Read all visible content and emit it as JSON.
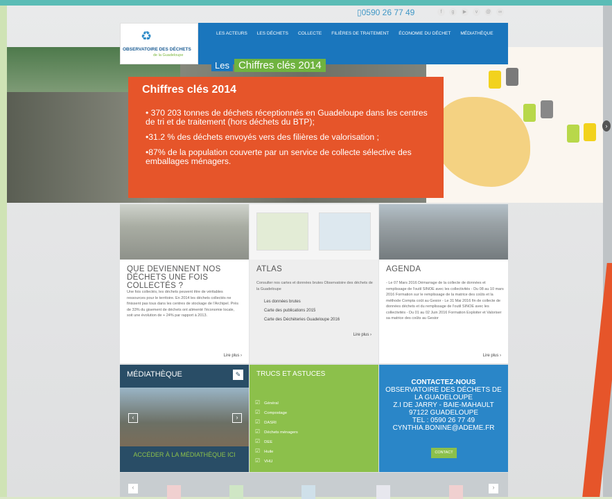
{
  "header": {
    "phone": "0590 26 77 49",
    "logo_name": "OBSERVATOIRE DES DÉCHETS",
    "logo_sub": "de la Guadeloupe",
    "nav": [
      "LES ACTEURS",
      "LES DÉCHETS",
      "COLLECTE",
      "FILIÈRES DE TRAITEMENT",
      "ÉCONOMIE DU DÉCHET",
      "MÉDIATHÈQUE"
    ]
  },
  "hero": {
    "badge_les": "Les",
    "badge_title": "Chiffres clés 2014",
    "title": "Chiffres clés 2014",
    "bullets": [
      "• 370 203 tonnes de déchets réceptionnés en Guadeloupe dans les centres de tri et de traitement (hors déchets du BTP);",
      "•31.2 % des déchets envoyés vers des filières de valorisation ;",
      "•87% de la population couverte par un service de collecte sélective des emballages ménagers."
    ]
  },
  "col1": {
    "title": "QUE DEVIENNENT NOS DÉCHETS UNE FOIS COLLECTÉS ?",
    "text": "Une fois collectés, les déchets peuvent être de véritables ressources pour le territoire. En 2014 les déchets collectés ne finissent pas tous dans les centres de stockage de l'Archipel. Près de 33% du gisement de déchets ont alimenté l'économie locale, soit une évolution de + 24% par rapport à 2013.",
    "more": "Lire plus ›"
  },
  "col2": {
    "title": "ATLAS",
    "text": "Consulter nos cartes et données brutes Observatoire des déchets de la Guadeloupe",
    "links": [
      "Les données brutes",
      "Carte des publications 2015",
      "Carte des Déchèteries Guadeloupe 2016"
    ],
    "more": "Lire plus ›"
  },
  "col3": {
    "title": "AGENDA",
    "text": "- Le 07 Mars 2016 Démarrage de la collecte de données et remplissage de l'outil SINOE avec les collectivités - Du 08 au 10 mars 2016 Formation sur le remplissage de la matrice des coûts et la méthode Compta coût au Gesior - Le 31 Mai 2016 fin de collecte de données déchets et du remplissage de l'outil SINOE avec les collectivités - Du 01 au 02 Juin 2016 Formation Exploiter et Valoriser sa matrice des coûts au Gesior",
    "more": "Lire plus ›"
  },
  "media": {
    "title": "MÉDIATHÈQUE",
    "cta": "ACCÉDER À LA MÉDIATHÈQUE ICI"
  },
  "tips": {
    "title": "TRUCS ET ASTUCES",
    "items": [
      "Général",
      "Compostage",
      "DASRI",
      "Déchets ménagers",
      "DEE",
      "Huile",
      "VHU"
    ]
  },
  "contact": {
    "title": "CONTACTEZ-NOUS",
    "lines": [
      "OBSERVATOIRE DES DÉCHETS DE",
      "LA GUADELOUPE",
      "Z.I DE JARRY - BAIE-MAHAULT",
      "97122 GUADELOUPE",
      "TEL : 0590 26 77 49",
      "CYNTHIA.BONINE@ADEME.FR"
    ],
    "button": "CONTACT"
  },
  "colors": {
    "blue": "#1a76bd",
    "orange": "#e6552a",
    "green": "#8cc04b",
    "navy": "#294d66"
  }
}
